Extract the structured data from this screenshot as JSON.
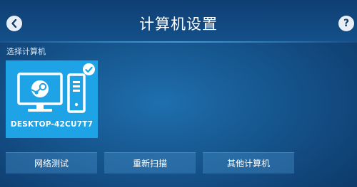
{
  "header": {
    "title": "计算机设置",
    "back_icon": "chevron-left-icon",
    "help_label": "?"
  },
  "section": {
    "label": "选择计算机"
  },
  "computers": [
    {
      "name": "DESKTOP-42CU7T7",
      "selected": true,
      "icons": [
        "monitor-icon",
        "steam-logo-icon",
        "tower-icon",
        "check-icon"
      ]
    }
  ],
  "actions": {
    "network_test": "网络测试",
    "rescan": "重新扫描",
    "other_computer": "其他计算机"
  },
  "colors": {
    "tile_accent": "#1ea3e6",
    "header_bg": "#0f3f73",
    "button_bg": "#3f7fb6"
  }
}
